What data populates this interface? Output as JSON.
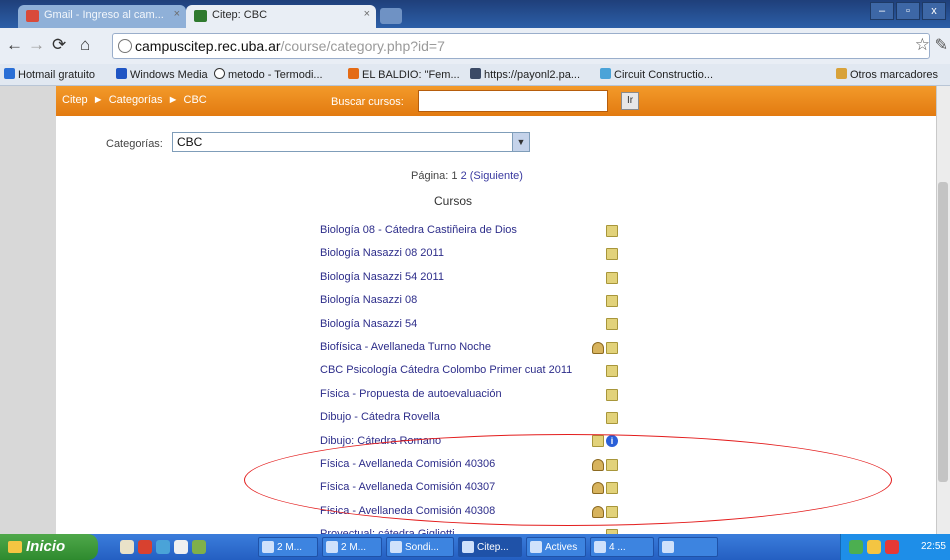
{
  "browser": {
    "tabs": [
      {
        "title": "Gmail - Ingreso al cam..."
      },
      {
        "title": "Citep: CBC"
      }
    ],
    "window_buttons": [
      "–",
      "▫",
      "x"
    ],
    "url_host": "campuscitep.rec.uba.ar",
    "url_path": "/course/category.php?id=7",
    "bookmarks": [
      "Hotmail gratuito",
      "Windows Media",
      "metodo - Termodi...",
      "EL BALDIO: \"Fem...",
      "https://payonl2.pa...",
      "Circuit Constructio...",
      "Otros marcadores"
    ]
  },
  "navbar": {
    "breadcrumb": [
      "Citep",
      "Categorías",
      "CBC"
    ],
    "search_label": "Buscar cursos:",
    "search_value": "",
    "search_button": "Ir"
  },
  "content": {
    "category_label": "Categorías:",
    "category_value": "CBC",
    "paging_prefix": "Página:",
    "page_current": "1",
    "page_2": "2",
    "page_next": "(Siguiente)",
    "courses_heading": "Cursos",
    "courses": [
      {
        "name": "Biología 08 - Cátedra Castiñeira de Dios",
        "icons": [
          "note"
        ]
      },
      {
        "name": "Biología Nasazzi 08 2011",
        "icons": [
          "note"
        ]
      },
      {
        "name": "Biología Nasazzi 54 2011",
        "icons": [
          "note"
        ]
      },
      {
        "name": "Biología Nasazzi 08",
        "icons": [
          "note"
        ]
      },
      {
        "name": "Biología Nasazzi 54",
        "icons": [
          "note"
        ]
      },
      {
        "name": "Biofísica - Avellaneda Turno Noche",
        "icons": [
          "people",
          "note"
        ]
      },
      {
        "name": "CBC Psicología Cátedra Colombo Primer cuat 2011",
        "icons": [
          "note"
        ]
      },
      {
        "name": "Física - Propuesta de autoevaluación",
        "icons": [
          "note"
        ]
      },
      {
        "name": "Dibujo - Cátedra Rovella",
        "icons": [
          "note"
        ]
      },
      {
        "name": "Dibujo: Cátedra Romano",
        "icons": [
          "note",
          "info"
        ]
      },
      {
        "name": "Física - Avellaneda Comisión 40306",
        "icons": [
          "people",
          "note"
        ]
      },
      {
        "name": "Física - Avellaneda Comisión 40307",
        "icons": [
          "people",
          "note"
        ]
      },
      {
        "name": "Física - Avellaneda Comisión 40308",
        "icons": [
          "people",
          "note"
        ]
      },
      {
        "name": "Proyectual: cátedra Gigliotti",
        "icons": [
          "note"
        ]
      }
    ]
  },
  "taskbar": {
    "start_label": "Inicio",
    "tasks": [
      "2 M...",
      "2 M...",
      "Sondi...",
      "Citep...",
      "Actives",
      "4 ...",
      ""
    ],
    "clock": "22:55"
  },
  "colors": {
    "accent": "#e8851a",
    "link": "#2d2d8a",
    "annotation": "#e31c1c"
  }
}
